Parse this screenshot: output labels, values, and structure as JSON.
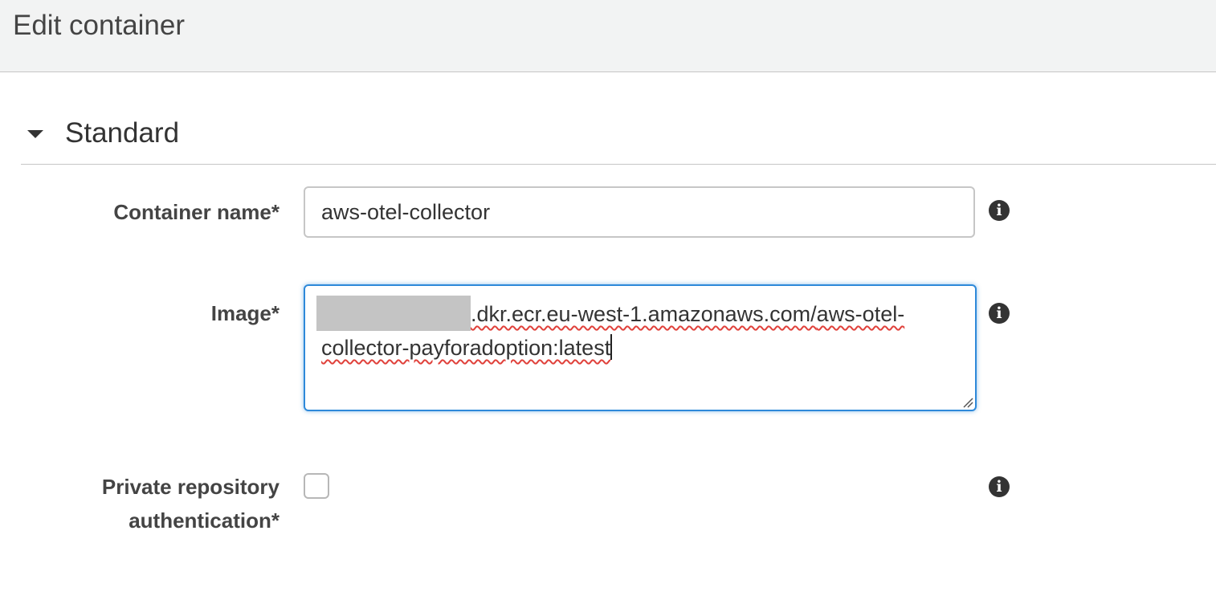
{
  "header": {
    "title": "Edit container"
  },
  "section": {
    "title": "Standard",
    "caret_icon": "caret-down-icon"
  },
  "fields": {
    "container_name": {
      "label": "Container name*",
      "value": "aws-otel-collector",
      "info_icon": "info-icon"
    },
    "image": {
      "label": "Image*",
      "value_part1": ".dkr.ecr.eu-west-1.amazonaws.com/",
      "value_part2": "aws-otel-",
      "value_part3": "collector-payforadoption:latest",
      "info_icon": "info-icon"
    },
    "private_repo_auth": {
      "label_line1": "Private repository",
      "label_line2": "authentication*",
      "checked": false,
      "info_icon": "info-icon"
    }
  },
  "colors": {
    "header_bg": "#f2f3f3",
    "focus_border": "#2e89d9",
    "spellcheck_underline": "#e0413b"
  }
}
